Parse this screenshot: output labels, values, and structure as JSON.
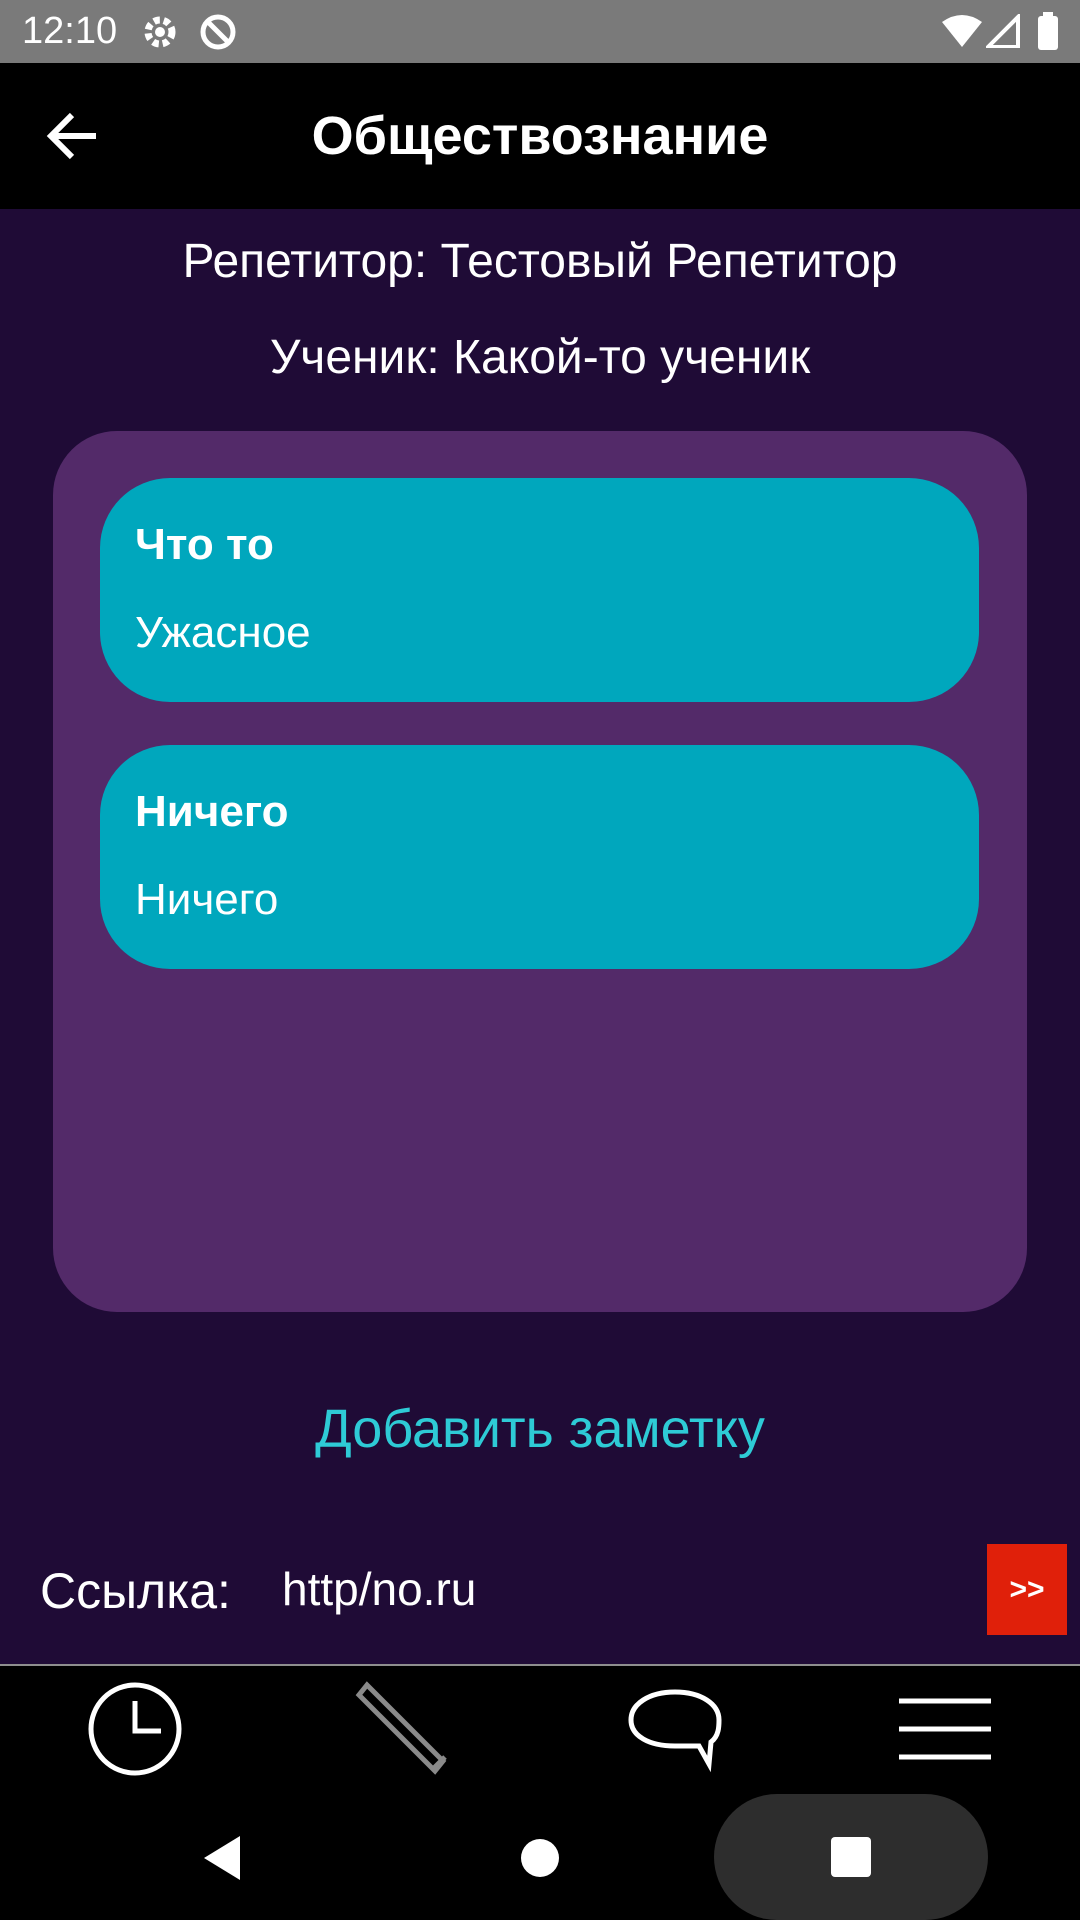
{
  "status_bar": {
    "time": "12:10"
  },
  "header": {
    "title": "Обществознание"
  },
  "info": {
    "tutor": "Репетитор: Тестовый Репетитор",
    "student": "Ученик: Какой-то ученик"
  },
  "notes": [
    {
      "title": "Что то",
      "body": "Ужасное"
    },
    {
      "title": "Ничего",
      "body": "Ничего"
    }
  ],
  "add_note_label": "Добавить заметку",
  "link": {
    "label": "Ссылка:",
    "value": "http/no.ru",
    "go_label": ">>"
  },
  "bottom_nav": {
    "items": [
      {
        "icon": "clock-icon"
      },
      {
        "icon": "pencil-icon"
      },
      {
        "icon": "chat-bubble-icon"
      },
      {
        "icon": "menu-icon"
      }
    ]
  },
  "colors": {
    "background": "#1f0b36",
    "panel": "#532a69",
    "card": "#00a7bd",
    "accent_link": "#2ecbd6",
    "go_button": "#e0200a"
  }
}
